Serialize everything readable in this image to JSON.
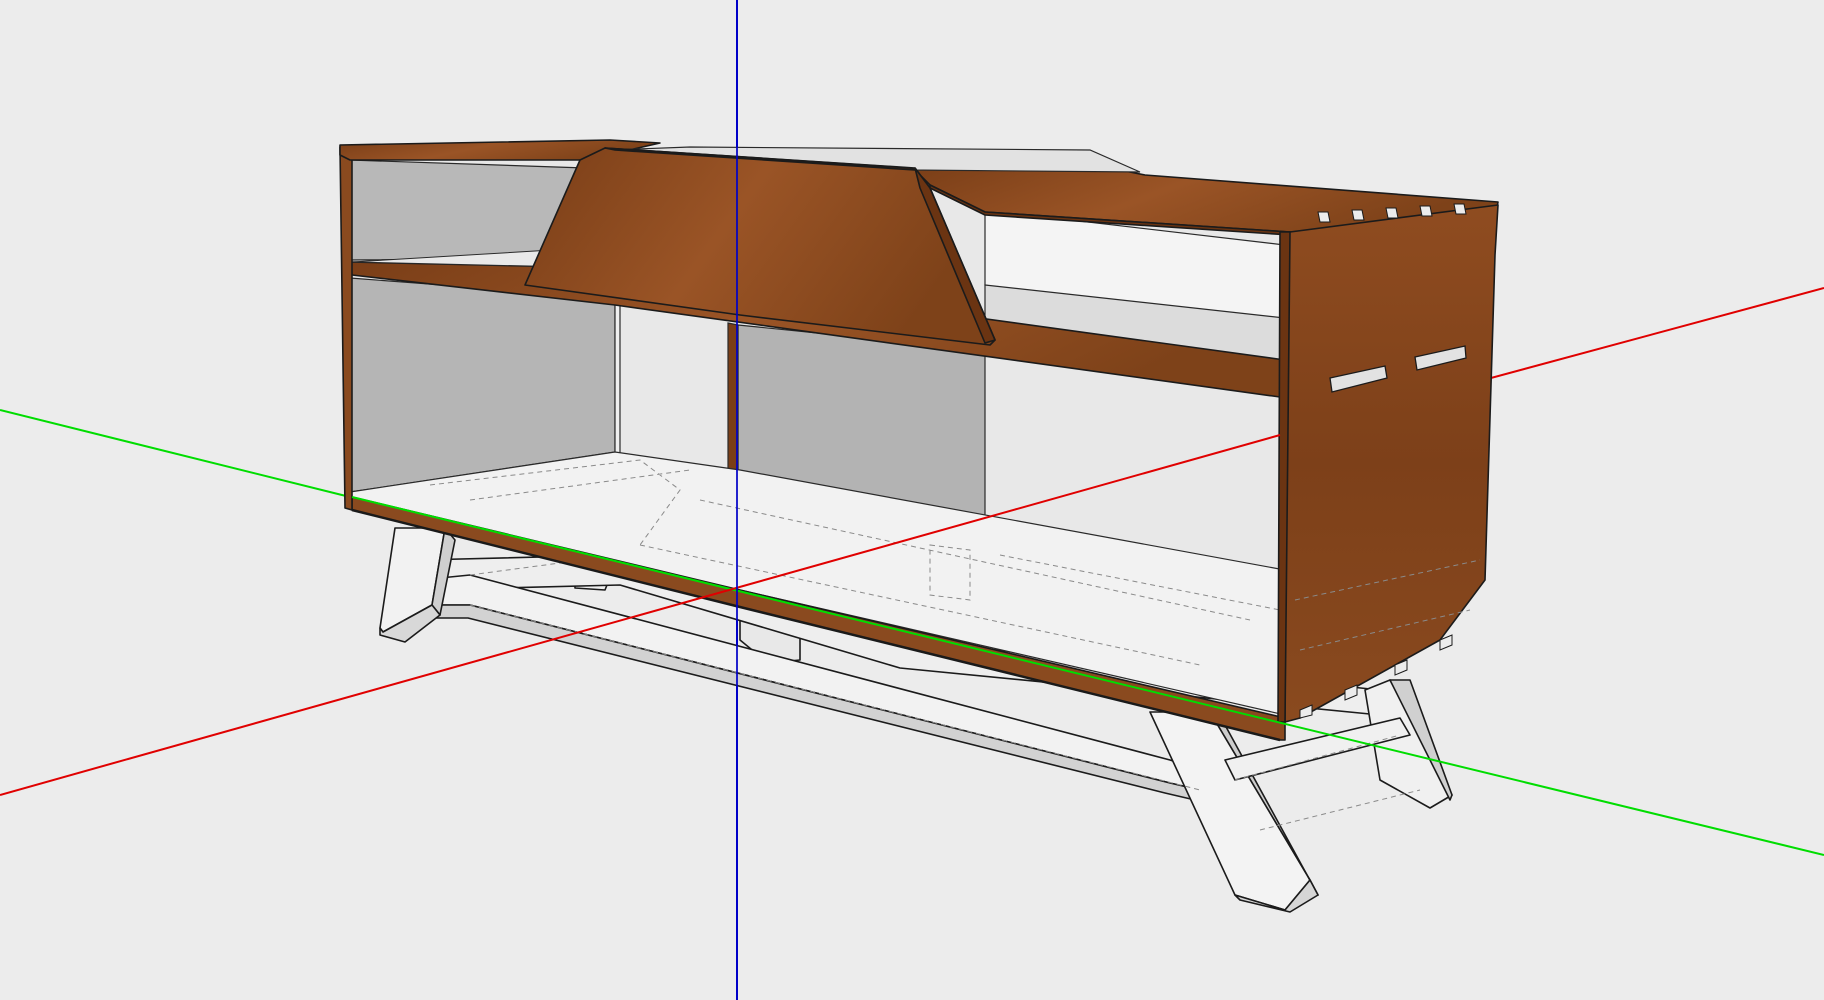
{
  "scene": {
    "view": "3d-model-viewport",
    "background_color": "#ececec",
    "axes": {
      "red_axis_color": "#e00000",
      "green_axis_color": "#00dd00",
      "blue_axis_color": "#0000c8"
    },
    "materials": {
      "wood_color": "#8a4a1f",
      "wood_dark_color": "#5c2e10",
      "wood_light_color": "#a0582a",
      "panel_gray_color": "#b7b7b7",
      "panel_light_color": "#e6e6e6",
      "leg_color": "#f0f0f0",
      "leg_shade_color": "#cfcfcf"
    },
    "model": {
      "object": "media-console-cabinet",
      "parts": [
        "top-panel-left",
        "top-panel-right",
        "center-sloped-lid",
        "center-top-opening",
        "right-side-panel",
        "left-side-panel",
        "middle-shelf",
        "center-divider",
        "bottom-panel",
        "back-panel",
        "finger-joints",
        "handle-slots",
        "base-frame",
        "legs"
      ]
    }
  }
}
